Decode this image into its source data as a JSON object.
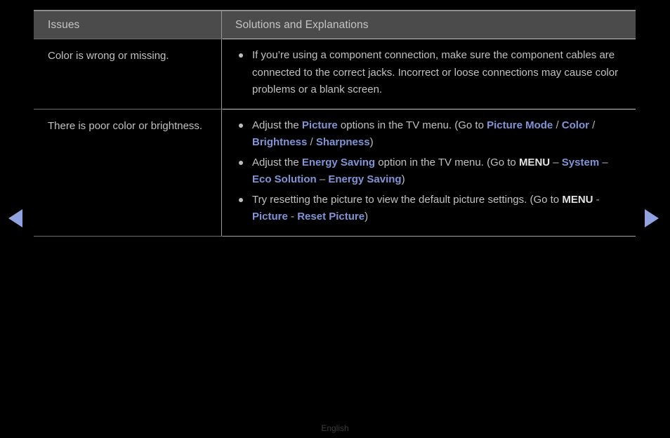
{
  "page": {
    "footer_language": "English",
    "accent_blue": "#8094d6",
    "header_bg": "#4b4b4b",
    "background": "#000000",
    "body_text_color": "#c1c1c1"
  },
  "table": {
    "headers": {
      "issues": "Issues",
      "solutions": "Solutions and Explanations"
    },
    "rows": [
      {
        "issue": "Color is wrong or missing.",
        "bullets": [
          {
            "segments": [
              {
                "text": "If you’re using a component connection, make sure the component cables are connected to the correct jacks. Incorrect or loose connections may cause color problems or a blank screen.",
                "style": "plain"
              }
            ]
          }
        ]
      },
      {
        "issue": "There is poor color or brightness.",
        "bullets": [
          {
            "segments": [
              {
                "text": "Adjust the ",
                "style": "plain"
              },
              {
                "text": "Picture",
                "style": "menu"
              },
              {
                "text": " options in the TV menu. (Go to ",
                "style": "plain"
              },
              {
                "text": "Picture Mode",
                "style": "menu"
              },
              {
                "text": " / ",
                "style": "slash"
              },
              {
                "text": "Color",
                "style": "menu"
              },
              {
                "text": " / ",
                "style": "slash"
              },
              {
                "text": "Brightness",
                "style": "menu"
              },
              {
                "text": " / ",
                "style": "slash"
              },
              {
                "text": "Sharpness",
                "style": "menu"
              },
              {
                "text": ")",
                "style": "plain"
              }
            ]
          },
          {
            "segments": [
              {
                "text": "Adjust the ",
                "style": "plain"
              },
              {
                "text": "Energy Saving",
                "style": "menu"
              },
              {
                "text": " option in the TV menu. (Go to ",
                "style": "plain"
              },
              {
                "text": "MENU",
                "style": "key"
              },
              {
                "text": " – ",
                "style": "slash"
              },
              {
                "text": "System",
                "style": "menu"
              },
              {
                "text": " – ",
                "style": "slash"
              },
              {
                "text": "Eco Solution",
                "style": "menu"
              },
              {
                "text": " – ",
                "style": "slash"
              },
              {
                "text": "Energy Saving",
                "style": "menu"
              },
              {
                "text": ")",
                "style": "plain"
              }
            ]
          },
          {
            "segments": [
              {
                "text": "Try resetting the picture to view the default picture settings. (Go to ",
                "style": "plain"
              },
              {
                "text": "MENU",
                "style": "key"
              },
              {
                "text": " - ",
                "style": "slash"
              },
              {
                "text": "Picture",
                "style": "menu"
              },
              {
                "text": " - ",
                "style": "slash"
              },
              {
                "text": "Reset Picture",
                "style": "menu"
              },
              {
                "text": ")",
                "style": "plain"
              }
            ]
          }
        ]
      }
    ]
  },
  "navigation": {
    "prev_label": "previous-page-arrow",
    "next_label": "next-page-arrow"
  }
}
